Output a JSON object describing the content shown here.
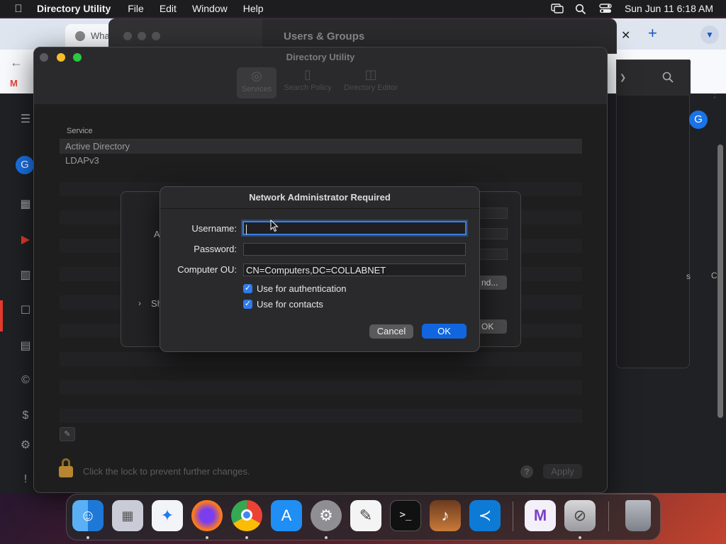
{
  "menubar": {
    "app_name": "Directory Utility",
    "menus": [
      "File",
      "Edit",
      "Window",
      "Help"
    ],
    "clock": "Sun Jun 11  6:18 AM"
  },
  "browser": {
    "tab_title": "Wha",
    "bookmark": "G",
    "avatar_letter": "G"
  },
  "users_window": {
    "title": "Users & Groups"
  },
  "directory_utility": {
    "title": "Directory Utility",
    "toolbar": {
      "services": "Services",
      "search_policy": "Search Policy",
      "directory_editor": "Directory Editor"
    },
    "table": {
      "header": "Service",
      "rows": [
        "Active Directory",
        "LDAPv3"
      ]
    },
    "lock_text": "Click the lock to prevent further changes.",
    "help_label": "?",
    "apply_label": "Apply"
  },
  "ad_sheet": {
    "label_a": "A",
    "show_label": "Sh",
    "bind_label": "nd...",
    "ok_label": "OK"
  },
  "dialog": {
    "title": "Network Administrator Required",
    "username_label": "Username:",
    "username_value": "",
    "password_label": "Password:",
    "password_value": "",
    "ou_label": "Computer OU:",
    "ou_value": "CN=Computers,DC=COLLABNET",
    "use_auth_label": "Use for authentication",
    "use_auth_checked": true,
    "use_contacts_label": "Use for contacts",
    "use_contacts_checked": true,
    "cancel_label": "Cancel",
    "ok_label": "OK"
  },
  "background_right": {
    "s_text": "s",
    "c_text": "C"
  },
  "colors": {
    "accent": "#1166e0",
    "checkbox": "#2f7bea",
    "lock": "#b8862f"
  },
  "dock": {
    "apps": [
      "finder-icon",
      "launchpad-icon",
      "safari-icon",
      "firefox-icon",
      "chrome-icon",
      "app-store-icon",
      "system-settings-icon",
      "textedit-icon",
      "terminal-icon",
      "garageband-icon",
      "vscode-icon",
      "visual-studio-icon",
      "directory-utility-icon",
      "trash-icon"
    ]
  }
}
